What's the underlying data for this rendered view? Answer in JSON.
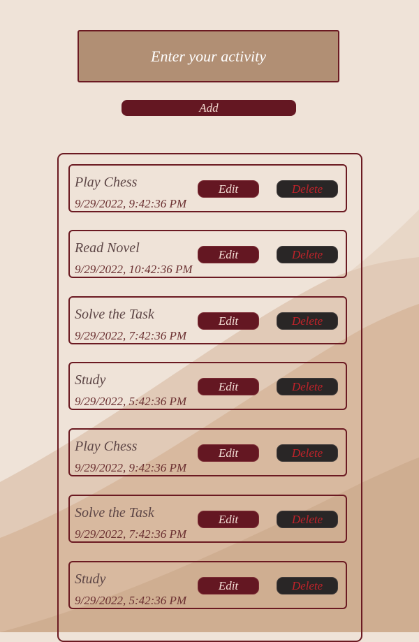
{
  "input": {
    "placeholder": "Enter your activity",
    "value": ""
  },
  "add_button": {
    "label": "Add"
  },
  "tasks": [
    {
      "name": "Play Chess",
      "time": "9/29/2022, 9:42:36 PM",
      "edit_label": "Edit",
      "delete_label": "Delete"
    },
    {
      "name": "Read Novel",
      "time": "9/29/2022, 10:42:36 PM",
      "edit_label": "Edit",
      "delete_label": "Delete"
    },
    {
      "name": "Solve the Task",
      "time": "9/29/2022, 7:42:36 PM",
      "edit_label": "Edit",
      "delete_label": "Delete"
    },
    {
      "name": "Study",
      "time": "9/29/2022, 5:42:36 PM",
      "edit_label": "Edit",
      "delete_label": "Delete"
    },
    {
      "name": "Play Chess",
      "time": "9/29/2022, 9:42:36 PM",
      "edit_label": "Edit",
      "delete_label": "Delete"
    },
    {
      "name": "Solve the Task",
      "time": "9/29/2022, 7:42:36 PM",
      "edit_label": "Edit",
      "delete_label": "Delete"
    },
    {
      "name": "Study",
      "time": "9/29/2022, 5:42:36 PM",
      "edit_label": "Edit",
      "delete_label": "Delete"
    }
  ],
  "colors": {
    "accent": "#641722",
    "border": "#6b1a22",
    "input_bg": "#b18f74",
    "delete_bg": "#292626",
    "delete_text": "#c0232a",
    "page_bg": "#efe3d8"
  }
}
